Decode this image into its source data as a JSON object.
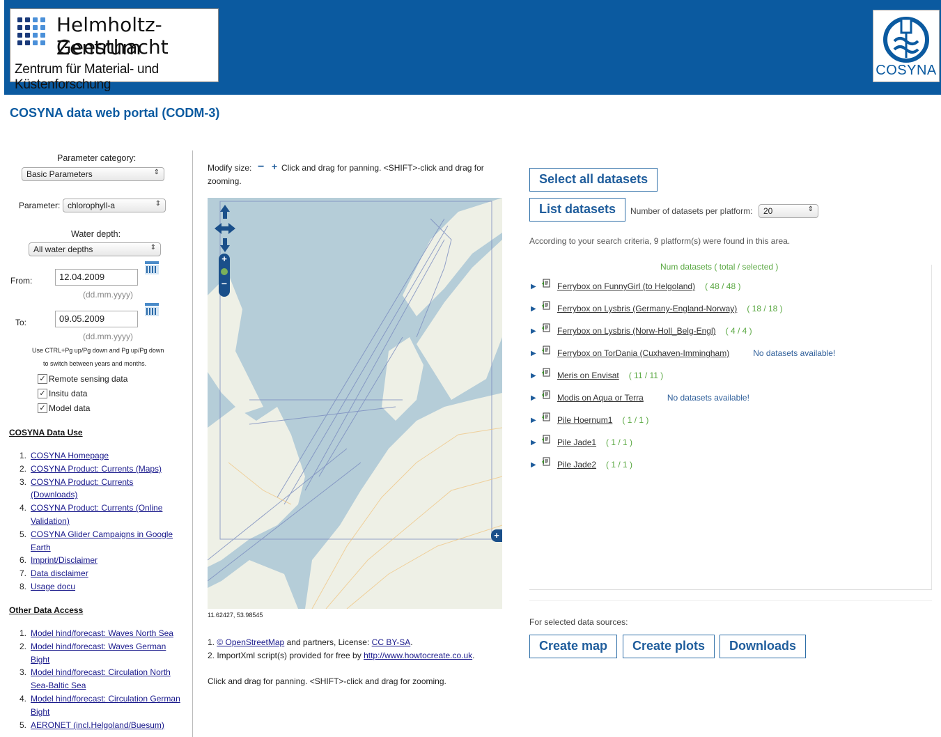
{
  "header": {
    "logo_left_line1": "Helmholtz-Zentrum",
    "logo_left_line2": "Geesthacht",
    "logo_left_line3": "Zentrum für Material- und Küstenforschung",
    "logo_right_text": "COSYNA",
    "brand_color": "#0b5aa0"
  },
  "page_title": "COSYNA data web portal (CODM-3)",
  "filters": {
    "param_category_label": "Parameter category:",
    "param_category_value": "Basic Parameters",
    "parameter_label": "Parameter:",
    "parameter_value": "chlorophyll-a",
    "water_depth_label": "Water depth:",
    "water_depth_value": "All water depths",
    "from_label": "From:",
    "from_value": "12.04.2009",
    "from_hint": "(dd.mm.yyyy)",
    "to_label": "To:",
    "to_value": "09.05.2009",
    "to_hint": "(dd.mm.yyyy)",
    "help_line1": "Use CTRL+Pg up/Pg down and Pg up/Pg down",
    "help_line2": "to switch between years and months.",
    "checkboxes": [
      "Remote sensing data",
      "Insitu data",
      "Model data"
    ]
  },
  "data_use": {
    "heading": "COSYNA Data Use",
    "items": [
      [
        "COSYNA Homepage"
      ],
      [
        "COSYNA Product: Currents (Maps)"
      ],
      [
        "COSYNA Product: Currents",
        "(Downloads)"
      ],
      [
        "COSYNA Product: Currents (Online",
        "Validation)"
      ],
      [
        "COSYNA Glider Campaigns in Google",
        "Earth"
      ],
      [
        "Imprint/Disclaimer"
      ],
      [
        "Data disclaimer"
      ],
      [
        "Usage docu"
      ]
    ]
  },
  "other_access": {
    "heading": "Other Data Access",
    "items": [
      [
        "Model hind/forecast: Waves North Sea"
      ],
      [
        "Model hind/forecast: Waves German",
        "Bight"
      ],
      [
        "Model hind/forecast: Circulation North",
        "Sea-Baltic Sea"
      ],
      [
        "Model hind/forecast: Circulation German",
        "Bight"
      ],
      [
        "AERONET (incl.Helgoland/Buesum)"
      ]
    ]
  },
  "map": {
    "modify_label": "Modify size:",
    "modify_help_1": "Click and drag for panning. <SHIFT>-click and drag for",
    "modify_help_2": "zooming.",
    "coords": "11.62427, 53.98545",
    "credit1_prefix": "1. ",
    "credit1_link": "© OpenStreetMap",
    "credit1_mid": " and partners, License: ",
    "credit1_license": "CC BY-SA",
    "credit1_end": ".",
    "credit2_prefix": "2. ImportXml script(s) provided for free by ",
    "credit2_link": "http://www.howtocreate.co.uk",
    "credit2_end": ".",
    "footer_help": "Click and drag for panning. <SHIFT>-click and drag for zooming."
  },
  "datasets": {
    "select_all": "Select all datasets",
    "list": "List datasets",
    "per_platform_label": "Number of datasets per platform:",
    "per_platform_value": "20",
    "criteria_text": "According to your search criteria, 9 platform(s) were found in this area.",
    "num_header": "Num datasets ( total / selected )",
    "platforms": [
      {
        "name": "Ferrybox on FunnyGirl (to Helgoland)",
        "count": "( 48 / 48 )"
      },
      {
        "name": "Ferrybox on Lysbris (Germany-England-Norway)",
        "count": "( 18 / 18 )"
      },
      {
        "name": "Ferrybox on Lysbris (Norw-Holl_Belg-Engl)",
        "count": "( 4 / 4 )"
      },
      {
        "name": "Ferrybox on TorDania (Cuxhaven-Immingham)",
        "none": "No datasets available!"
      },
      {
        "name": "Meris on Envisat",
        "count": "( 11 / 11 )"
      },
      {
        "name": "Modis on Aqua or Terra",
        "none": "No datasets available!"
      },
      {
        "name": "Pile Hoernum1",
        "count": "( 1 / 1 )"
      },
      {
        "name": "Pile Jade1",
        "count": "( 1 / 1 )"
      },
      {
        "name": "Pile Jade2",
        "count": "( 1 / 1 )"
      }
    ],
    "selected_label": "For selected data sources:",
    "create_map": "Create map",
    "create_plots": "Create plots",
    "downloads": "Downloads"
  }
}
